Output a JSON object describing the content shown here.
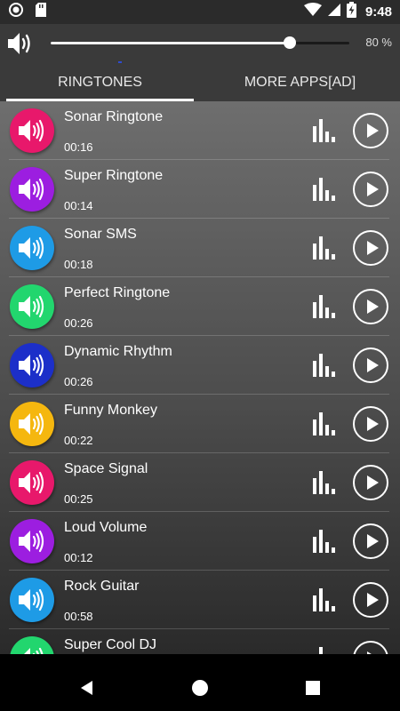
{
  "status_bar": {
    "time": "9:48",
    "icons": [
      "record-icon",
      "sd-card-icon",
      "wifi-icon",
      "signal-icon",
      "battery-charging-icon"
    ]
  },
  "volume": {
    "level": 0.8,
    "percent_text": "80 %"
  },
  "tabs": [
    {
      "label": "RINGTONES",
      "active": true
    },
    {
      "label": "MORE APPS[AD]",
      "active": false
    }
  ],
  "ringtones": [
    {
      "title": "Sonar Ringtone",
      "duration": "00:16",
      "color": "#e8186b"
    },
    {
      "title": "Super Ringtone",
      "duration": "00:14",
      "color": "#9c1ee0"
    },
    {
      "title": "Sonar SMS",
      "duration": "00:18",
      "color": "#1e9be6"
    },
    {
      "title": "Perfect Ringtone",
      "duration": "00:26",
      "color": "#22d66e"
    },
    {
      "title": "Dynamic Rhythm",
      "duration": "00:26",
      "color": "#1c2fc9"
    },
    {
      "title": "Funny Monkey",
      "duration": "00:22",
      "color": "#f5b70f"
    },
    {
      "title": "Space Signal",
      "duration": "00:25",
      "color": "#e8186b"
    },
    {
      "title": "Loud Volume",
      "duration": "00:12",
      "color": "#9c1ee0"
    },
    {
      "title": "Rock Guitar",
      "duration": "00:58",
      "color": "#1e9be6"
    },
    {
      "title": "Super Cool DJ",
      "duration": "",
      "color": "#22d66e"
    }
  ],
  "nav": {
    "buttons": [
      "back-icon",
      "home-icon",
      "recents-icon"
    ]
  }
}
